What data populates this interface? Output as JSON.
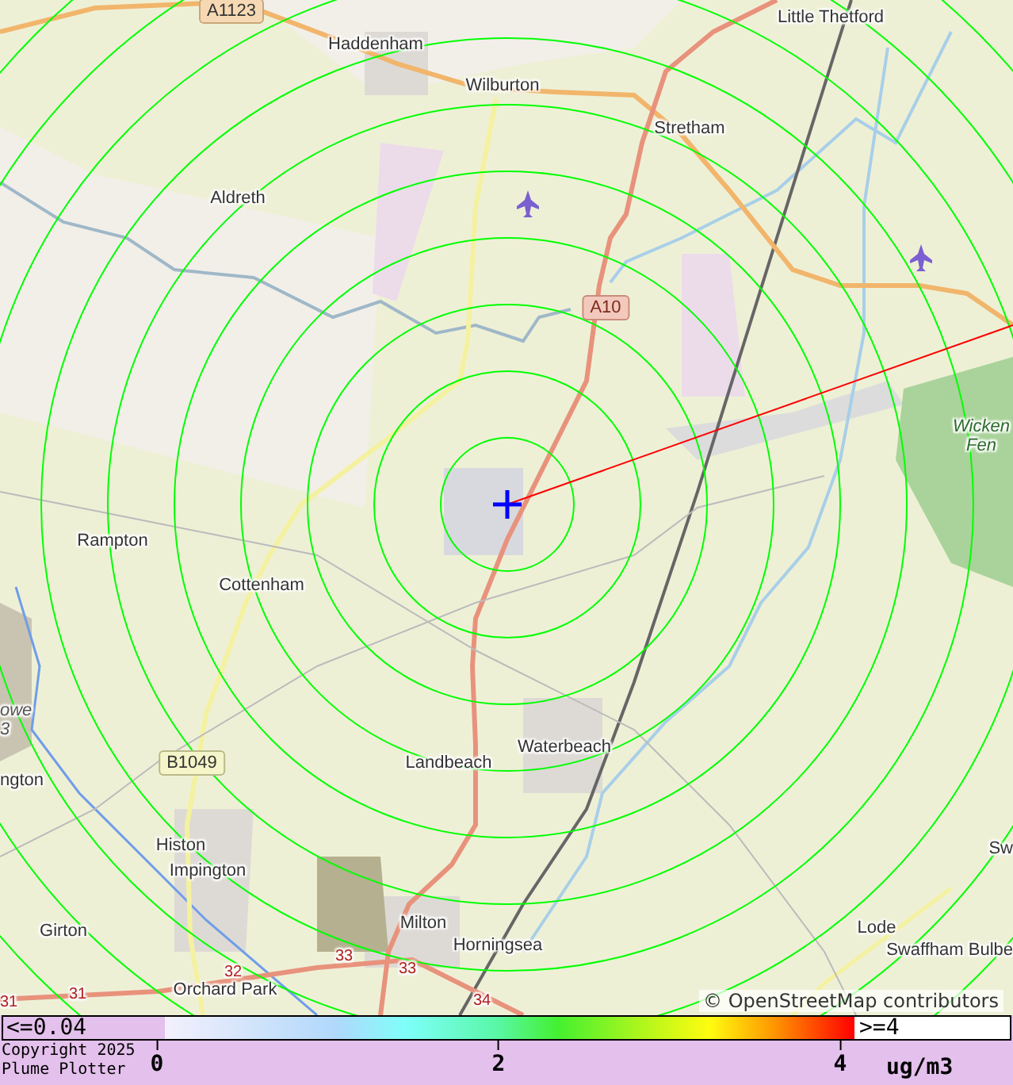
{
  "map": {
    "labels": [
      {
        "text": "A1123",
        "kind": "road_primary"
      },
      {
        "text": "Little Thetford",
        "kind": "place"
      },
      {
        "text": "Haddenham",
        "kind": "place"
      },
      {
        "text": "Wilburton",
        "kind": "place"
      },
      {
        "text": "Stretham",
        "kind": "place"
      },
      {
        "text": "Aldreth",
        "kind": "place"
      },
      {
        "text": "A10",
        "kind": "road_trunk"
      },
      {
        "text": "Wicken Fen",
        "kind": "nature"
      },
      {
        "text": "Rampton",
        "kind": "place"
      },
      {
        "text": "Cottenham",
        "kind": "place"
      },
      {
        "text": "owe",
        "kind": "nature"
      },
      {
        "text": "3",
        "kind": "nature"
      },
      {
        "text": "B1049",
        "kind": "road_secondary"
      },
      {
        "text": "Landbeach",
        "kind": "place"
      },
      {
        "text": "Waterbeach",
        "kind": "place"
      },
      {
        "text": "ngton",
        "kind": "place"
      },
      {
        "text": "Histon",
        "kind": "place"
      },
      {
        "text": "Sw",
        "kind": "place"
      },
      {
        "text": "Impington",
        "kind": "place"
      },
      {
        "text": "Girton",
        "kind": "place"
      },
      {
        "text": "Milton",
        "kind": "place"
      },
      {
        "text": "Lode",
        "kind": "place"
      },
      {
        "text": "Horningsea",
        "kind": "place"
      },
      {
        "text": "Swaffham Bulbe",
        "kind": "place"
      },
      {
        "text": "33",
        "kind": "junction"
      },
      {
        "text": "32",
        "kind": "junction"
      },
      {
        "text": "33",
        "kind": "junction"
      },
      {
        "text": "31",
        "kind": "junction"
      },
      {
        "text": "31",
        "kind": "junction"
      },
      {
        "text": "Orchard Park",
        "kind": "place"
      },
      {
        "text": "34",
        "kind": "junction"
      }
    ],
    "attribution": "© OpenStreetMap contributors"
  },
  "legend": {
    "min_label": "<=0.04",
    "max_label": ">=4",
    "ticks": [
      "0",
      "2",
      "4"
    ],
    "unit": "ug/m3",
    "copyright": [
      "Copyright 2025",
      "Plume Plotter"
    ]
  }
}
